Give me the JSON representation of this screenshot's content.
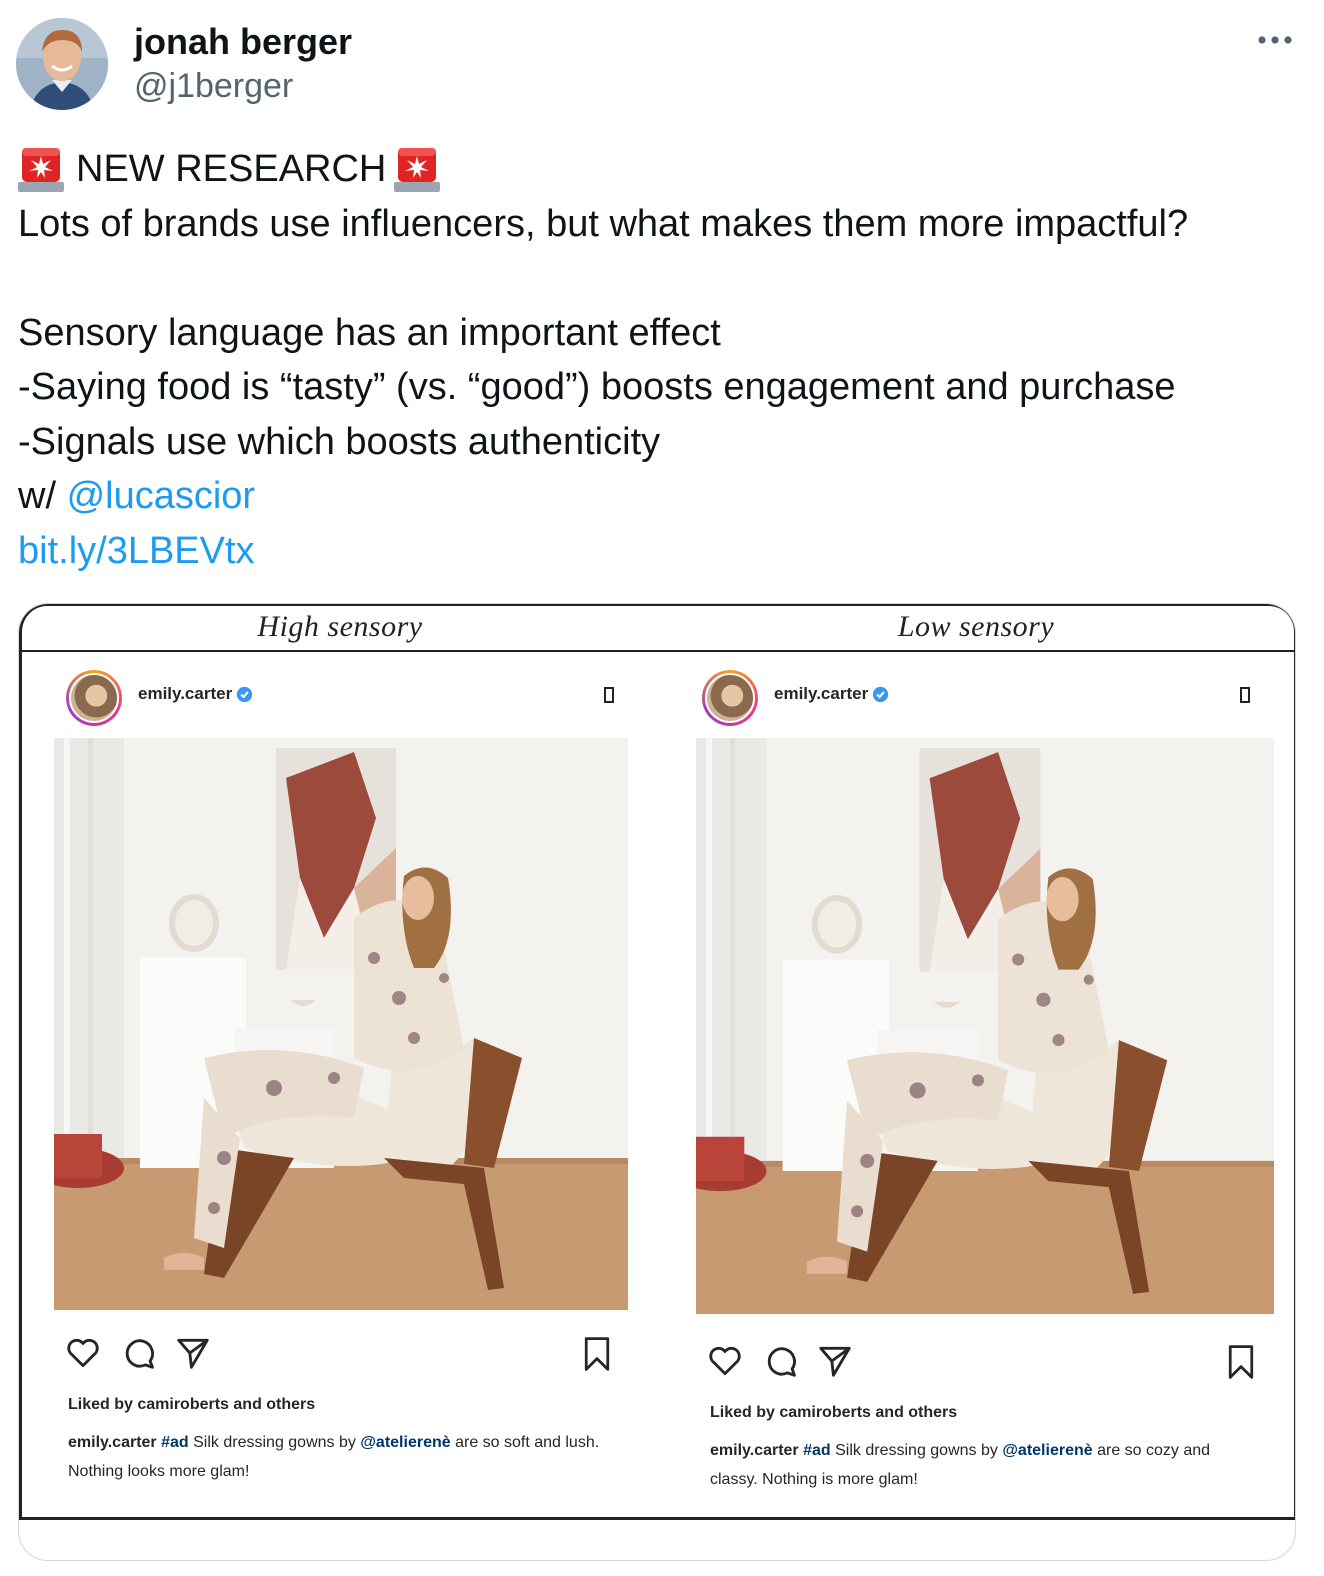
{
  "tweet": {
    "author_name": "jonah berger",
    "author_handle": "@j1berger",
    "lines": {
      "headline": "NEW RESEARCH",
      "l1": "Lots of brands use influencers, but what makes them more impactful?",
      "l3": "Sensory language has an important effect",
      "l4": "-Saying food is “tasty” (vs. “good”) boosts engagement and purchase",
      "l5": "-Signals use which boosts authenticity",
      "l6_prefix": "w/ ",
      "mention": "@lucascior",
      "url": "bit.ly/3LBEVtx"
    },
    "icons": {
      "siren": "police-light-icon",
      "more": "more-icon"
    },
    "colors": {
      "link": "#1d9bf0",
      "siren": "#e02424"
    }
  },
  "figure": {
    "left_header": "High sensory",
    "right_header": "Low sensory",
    "left_post": {
      "username": "emily.carter",
      "liked_by": "Liked by camiroberts and others",
      "caption_user": "emily.carter",
      "caption_tag": "#ad",
      "caption_mid": " Silk dressing gowns by ",
      "caption_mention": "@atelierenè",
      "caption_rest": " are so soft and lush. Nothing looks more glam!"
    },
    "right_post": {
      "username": "emily.carter",
      "liked_by": "Liked by camiroberts and others",
      "caption_user": "emily.carter",
      "caption_tag": "#ad",
      "caption_mid": " Silk dressing gowns by ",
      "caption_mention": "@atelierenè",
      "caption_rest": " are so cozy and classy. Nothing is more glam!"
    }
  }
}
